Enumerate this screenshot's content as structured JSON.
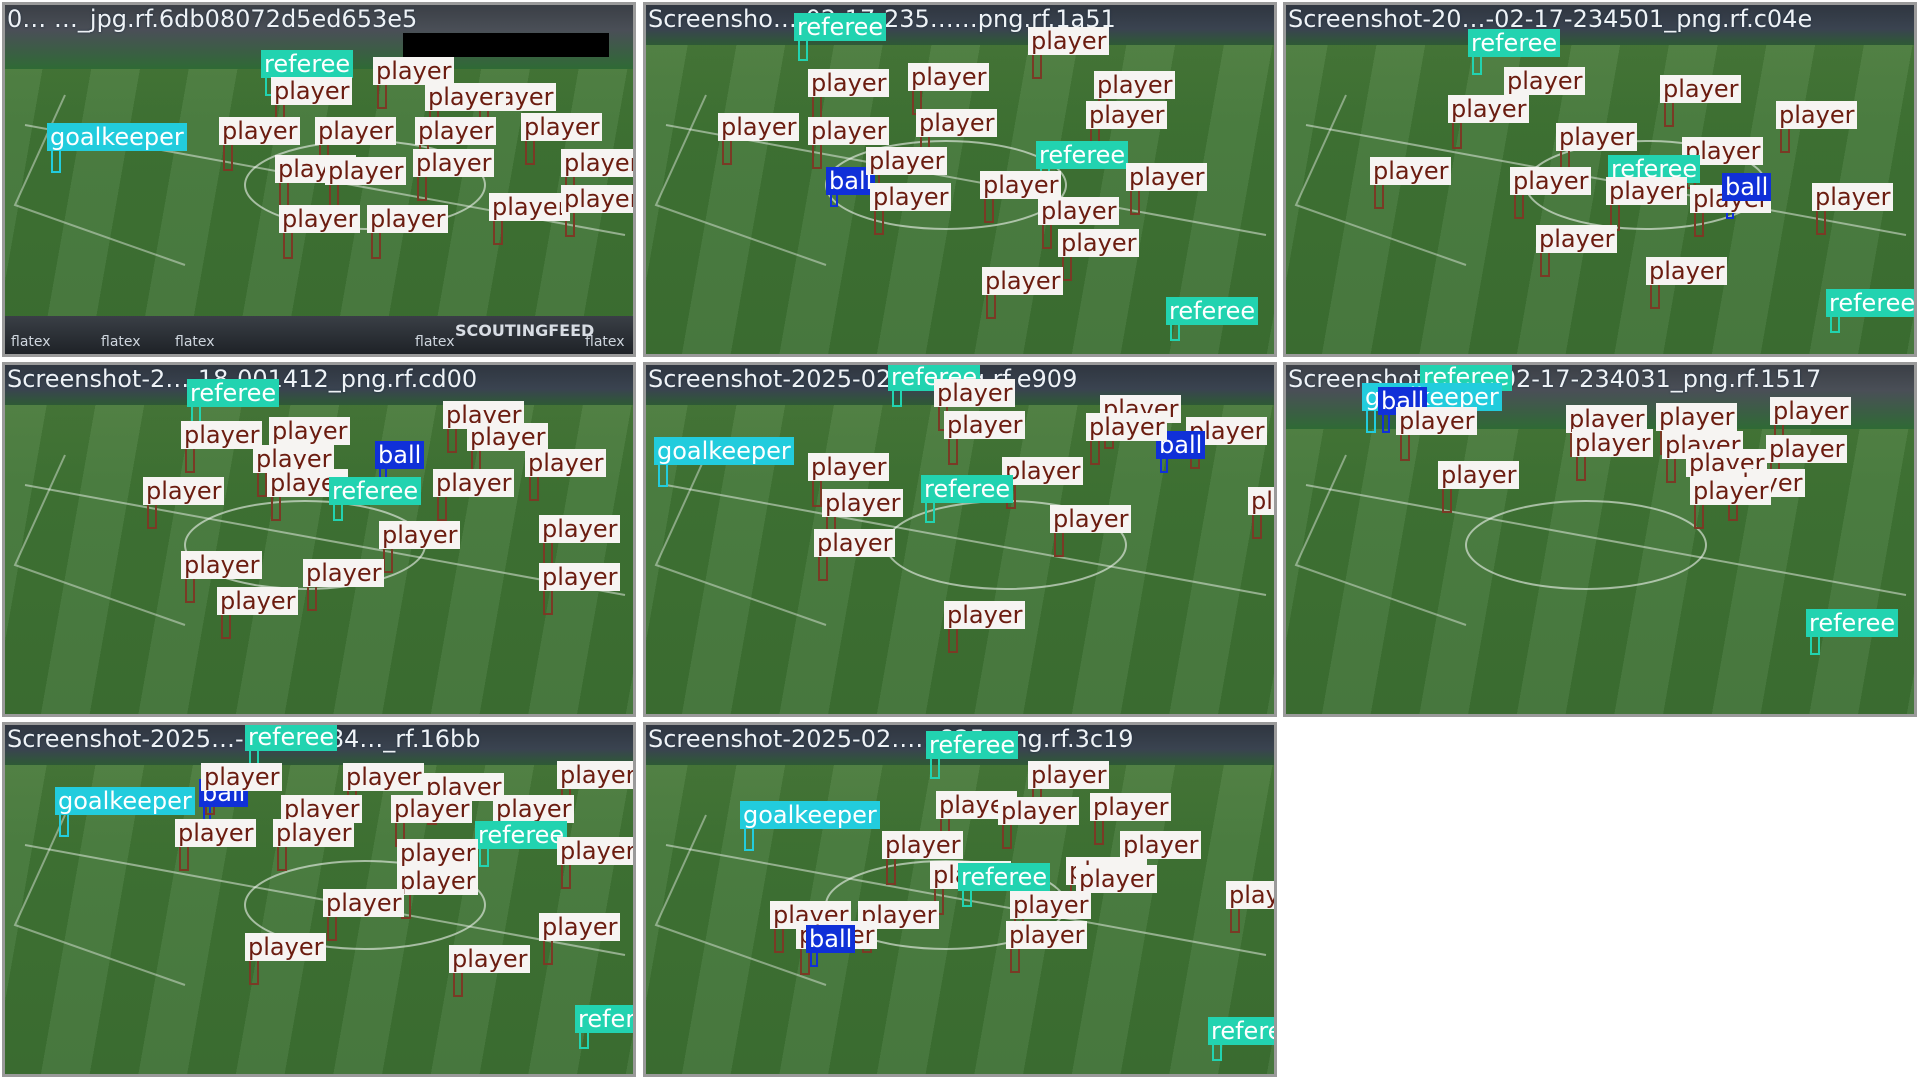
{
  "colors": {
    "player_bg": "#f6f4f2",
    "player_text": "#6b1c10",
    "referee_bg": "#22d3b0",
    "goalkeeper_bg": "#22ccdd",
    "ball_bg": "#1030d8"
  },
  "class_names": {
    "player": "player",
    "referee": "referee",
    "goalkeeper": "goalkeeper",
    "ball": "ball"
  },
  "tiles": [
    {
      "caption": "0… …_jpg.rf.6db08072d5ed653e5",
      "banner_texts": [
        "flatex",
        "flatex",
        "flatex",
        "flatex",
        "flatex",
        "SCOUTINGFEED"
      ]
    },
    {
      "caption": "Screensho…-02-17-235……png.rf.1a51"
    },
    {
      "caption": "Screenshot-20…-02-17-234501_png.rf.c04e"
    },
    {
      "caption": "Screenshot-2…-18-001412_png.rf.cd00"
    },
    {
      "caption": "Screenshot-2025-02……png.rf.e909"
    },
    {
      "caption": "Screenshot-2025-02-17-234031_png.rf.1517"
    },
    {
      "caption": "Screenshot-2025…-17-23584…_rf.16bb"
    },
    {
      "caption": "Screenshot-2025-02……825_png.rf.3c19"
    }
  ]
}
